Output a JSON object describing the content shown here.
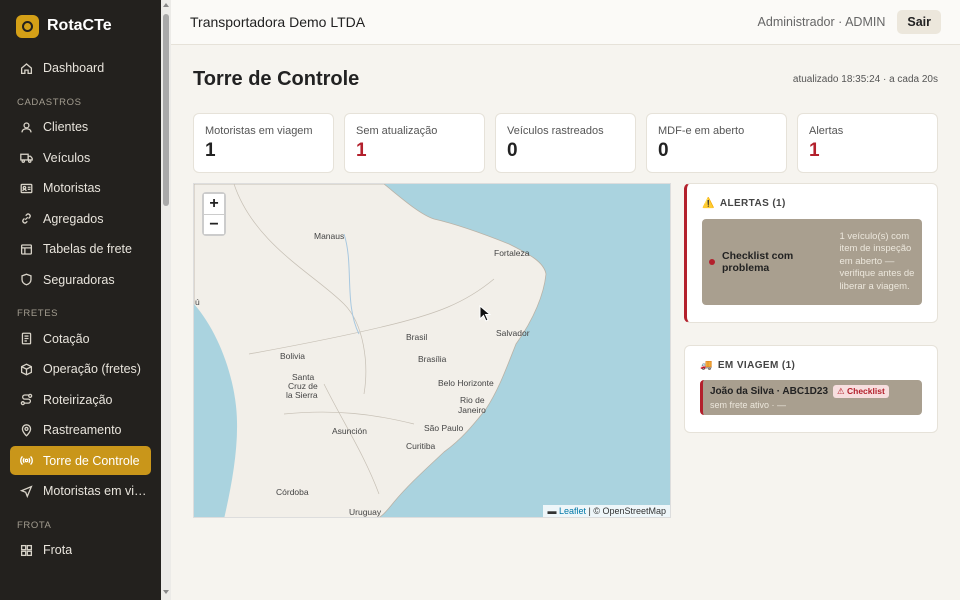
{
  "brand": {
    "name": "RotaCTe",
    "accent": "#c9961a"
  },
  "sidebar": {
    "items": [
      {
        "label": "Dashboard",
        "icon": "home-icon"
      },
      {
        "section": "CADASTROS"
      },
      {
        "label": "Clientes",
        "icon": "user-icon"
      },
      {
        "label": "Veículos",
        "icon": "truck-icon"
      },
      {
        "label": "Motoristas",
        "icon": "id-card-icon"
      },
      {
        "label": "Agregados",
        "icon": "link-icon"
      },
      {
        "label": "Tabelas de frete",
        "icon": "table-icon"
      },
      {
        "label": "Seguradoras",
        "icon": "shield-icon"
      },
      {
        "section": "FRETES"
      },
      {
        "label": "Cotação",
        "icon": "document-icon"
      },
      {
        "label": "Operação (fretes)",
        "icon": "box-icon"
      },
      {
        "label": "Roteirização",
        "icon": "route-icon"
      },
      {
        "label": "Rastreamento",
        "icon": "pin-icon"
      },
      {
        "label": "Torre de Controle",
        "icon": "radio-tower-icon",
        "active": true
      },
      {
        "label": "Motoristas em viag...",
        "icon": "navigation-icon"
      },
      {
        "section": "FROTA"
      },
      {
        "label": "Frota",
        "icon": "grid-icon"
      }
    ]
  },
  "header": {
    "company": "Transportadora Demo LTDA",
    "user": "Administrador · ADMIN",
    "logout_label": "Sair"
  },
  "main": {
    "title": "Torre de Controle",
    "updated": "atualizado 18:35:24 · a cada 20s",
    "stats": [
      {
        "label": "Motoristas em viagem",
        "value": "1",
        "alert": false
      },
      {
        "label": "Sem atualização",
        "value": "1",
        "alert": true
      },
      {
        "label": "Veículos rastreados",
        "value": "0",
        "alert": false
      },
      {
        "label": "MDF-e em aberto",
        "value": "0",
        "alert": false
      },
      {
        "label": "Alertas",
        "value": "1",
        "alert": true
      }
    ]
  },
  "map": {
    "zoom_in": "+",
    "zoom_out": "−",
    "attribution_link": "Leaflet",
    "attribution_text": " | © OpenStreetMap",
    "cities": [
      "Manaus",
      "Fortaleza",
      "Salvador",
      "Brasil",
      "Brasília",
      "Bolivia",
      "Santa",
      "Cruz de",
      "la Sierra",
      "Belo Horizonte",
      "Rio de",
      "Janeiro",
      "São Paulo",
      "Asunción",
      "Curitiba",
      "Córdoba",
      "Uruguay",
      "ú"
    ]
  },
  "alerts": {
    "emoji": "⚠️",
    "title": "ALERTAS (1)",
    "items": [
      {
        "name": "Checklist com problema",
        "description": "1 veículo(s) com item de inspeção em aberto — verifique antes de liberar a viagem."
      }
    ]
  },
  "trips": {
    "emoji": "🚚",
    "title": "EM VIAGEM (1)",
    "items": [
      {
        "name": "João da Silva · ABC1D23",
        "badge": "⚠ Checklist",
        "sub": "sem frete ativo · —"
      }
    ]
  }
}
